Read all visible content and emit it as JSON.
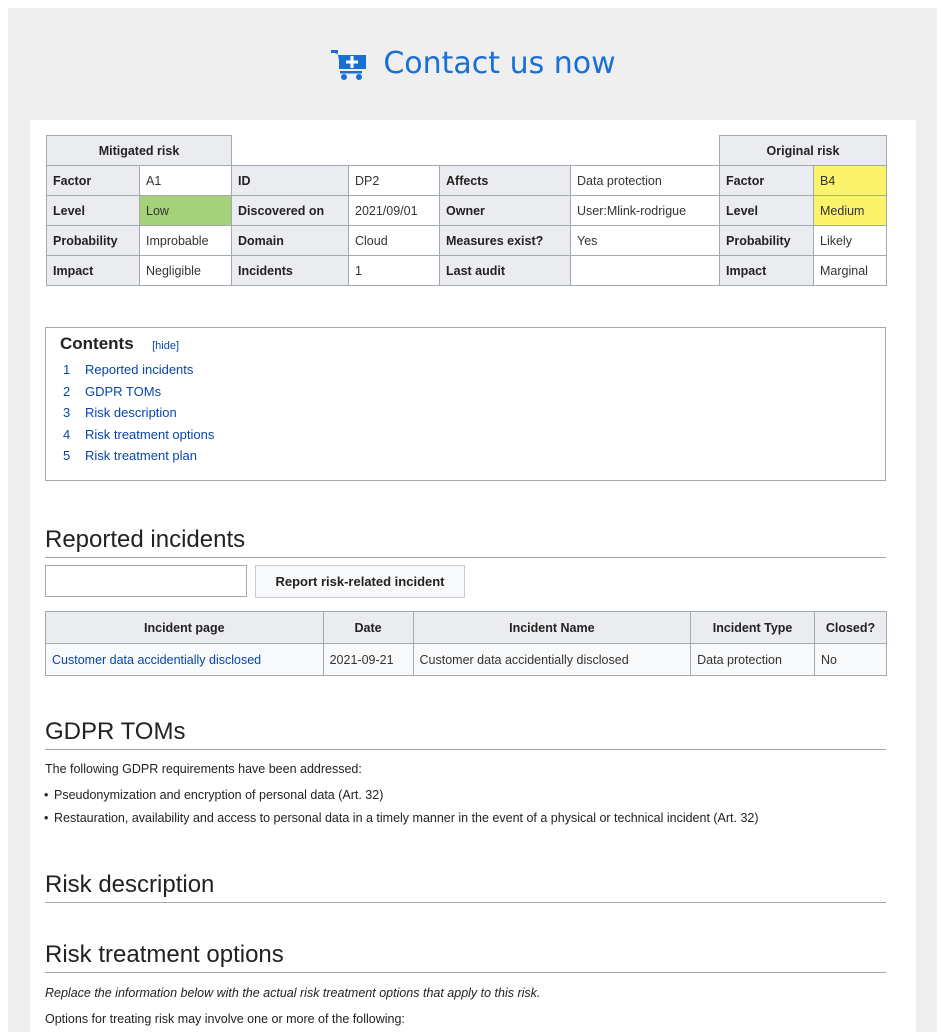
{
  "contact": {
    "label": "Contact us now",
    "icon": "cart-plus-icon",
    "color": "#1a6fd6"
  },
  "risk_table": {
    "mitigated_header": "Mitigated risk",
    "original_header": "Original risk",
    "rows": [
      [
        "Factor",
        "A1",
        "ID",
        "DP2",
        "Affects",
        "Data protection",
        "Factor",
        "B4"
      ],
      [
        "Level",
        "Low",
        "Discovered on",
        "2021/09/01",
        "Owner",
        "User:Mlink-rodrigue",
        "Level",
        "Medium"
      ],
      [
        "Probability",
        "Improbable",
        "Domain",
        "Cloud",
        "Measures exist?",
        "Yes",
        "Probability",
        "Likely"
      ],
      [
        "Impact",
        "Negligible",
        "Incidents",
        "1",
        "Last audit",
        "",
        "Impact",
        "Marginal"
      ]
    ],
    "colors": {
      "low": "#a4d27a",
      "medium": "#fbf36c"
    }
  },
  "toc": {
    "title": "Contents",
    "hide_label": "[hide]",
    "items": [
      {
        "num": "1",
        "label": "Reported incidents"
      },
      {
        "num": "2",
        "label": "GDPR TOMs"
      },
      {
        "num": "3",
        "label": "Risk description"
      },
      {
        "num": "4",
        "label": "Risk treatment options"
      },
      {
        "num": "5",
        "label": "Risk treatment plan"
      }
    ]
  },
  "reported": {
    "heading": "Reported incidents",
    "input_value": "",
    "button_label": "Report risk-related incident",
    "columns": [
      "Incident page",
      "Date",
      "Incident Name",
      "Incident Type",
      "Closed?"
    ],
    "rows": [
      [
        "Customer data accidentially disclosed",
        "2021-09-21",
        "Customer data accidentially disclosed",
        "Data protection",
        "No"
      ]
    ]
  },
  "gdpr": {
    "heading": "GDPR TOMs",
    "intro": "The following GDPR requirements have been addressed:",
    "items": [
      "Pseudonymization and encryption of personal data (Art. 32)",
      "Restauration, availability and access to personal data in a timely manner in the event of a physical or technical incident (Art. 32)"
    ]
  },
  "risk_description": {
    "heading": "Risk description"
  },
  "treatment": {
    "heading": "Risk treatment options",
    "intro": "Replace the information below with the actual risk treatment options that apply to this risk.",
    "partial_line": "Options for treating risk may involve one or more of the following:"
  }
}
